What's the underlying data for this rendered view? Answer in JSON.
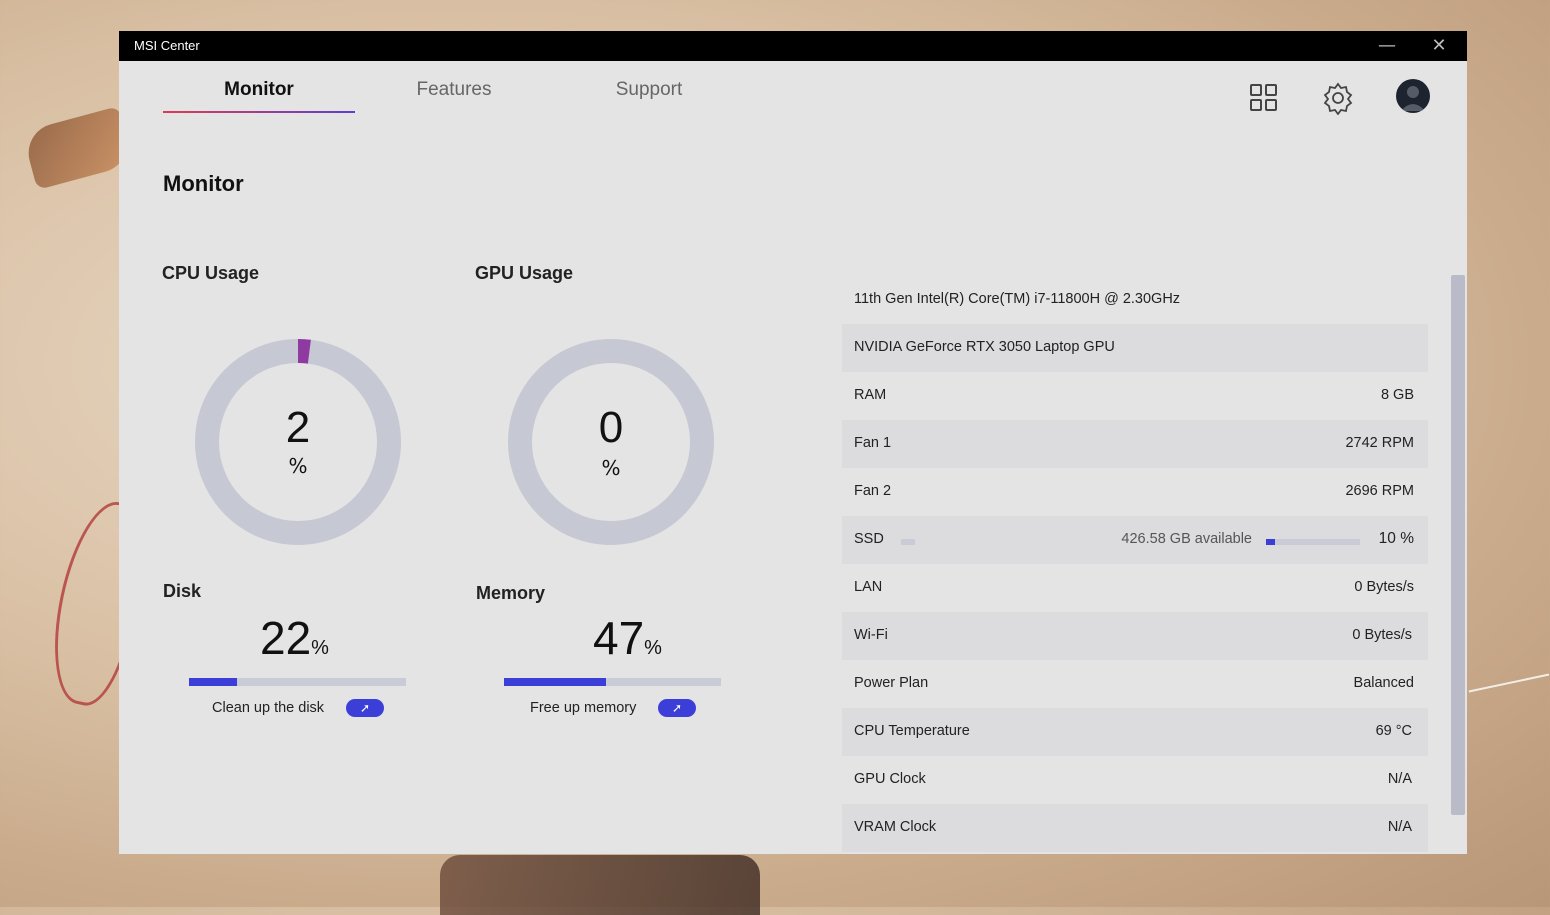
{
  "window": {
    "title": "MSI Center",
    "minimize_glyph": "—",
    "close_glyph": "✕"
  },
  "tabs": [
    {
      "label": "Monitor"
    },
    {
      "label": "Features"
    },
    {
      "label": "Support"
    }
  ],
  "header_icons": [
    "grid-icon",
    "gear-icon",
    "avatar-icon"
  ],
  "page": {
    "title": "Monitor"
  },
  "cpu": {
    "label": "CPU Usage",
    "value": "2",
    "unit": "%",
    "percent": 2
  },
  "gpu": {
    "label": "GPU Usage",
    "value": "0",
    "unit": "%",
    "percent": 0
  },
  "disk": {
    "label": "Disk",
    "value": "22",
    "unit": "%",
    "percent": 22,
    "action": "Clean up the disk"
  },
  "memory": {
    "label": "Memory",
    "value": "47",
    "unit": "%",
    "percent": 47,
    "action": "Free up memory"
  },
  "info": {
    "cpu_name": "11th Gen Intel(R) Core(TM) i7-11800H @ 2.30GHz",
    "gpu_name": "NVIDIA GeForce RTX 3050 Laptop GPU",
    "rows": [
      {
        "key": "RAM",
        "value": "8 GB"
      },
      {
        "key": "Fan 1",
        "value": "2742 RPM"
      },
      {
        "key": "Fan 2",
        "value": "2696 RPM"
      }
    ],
    "ssd": {
      "key": "SSD",
      "available": "426.58 GB available",
      "value": "10 %",
      "percent": 10
    },
    "rows2": [
      {
        "key": "LAN",
        "value": "0 Bytes/s"
      },
      {
        "key": "Wi-Fi",
        "value": "0 Bytes/s"
      },
      {
        "key": "Power Plan",
        "value": "Balanced"
      },
      {
        "key": "CPU Temperature",
        "value": "69 °C"
      },
      {
        "key": "GPU Clock",
        "value": "N/A"
      },
      {
        "key": "VRAM Clock",
        "value": "N/A"
      }
    ]
  },
  "colors": {
    "accent": "#3b3fd8",
    "cpu_ring_fill": "#8e3aa0",
    "ring_track": "#c6c9d3"
  }
}
